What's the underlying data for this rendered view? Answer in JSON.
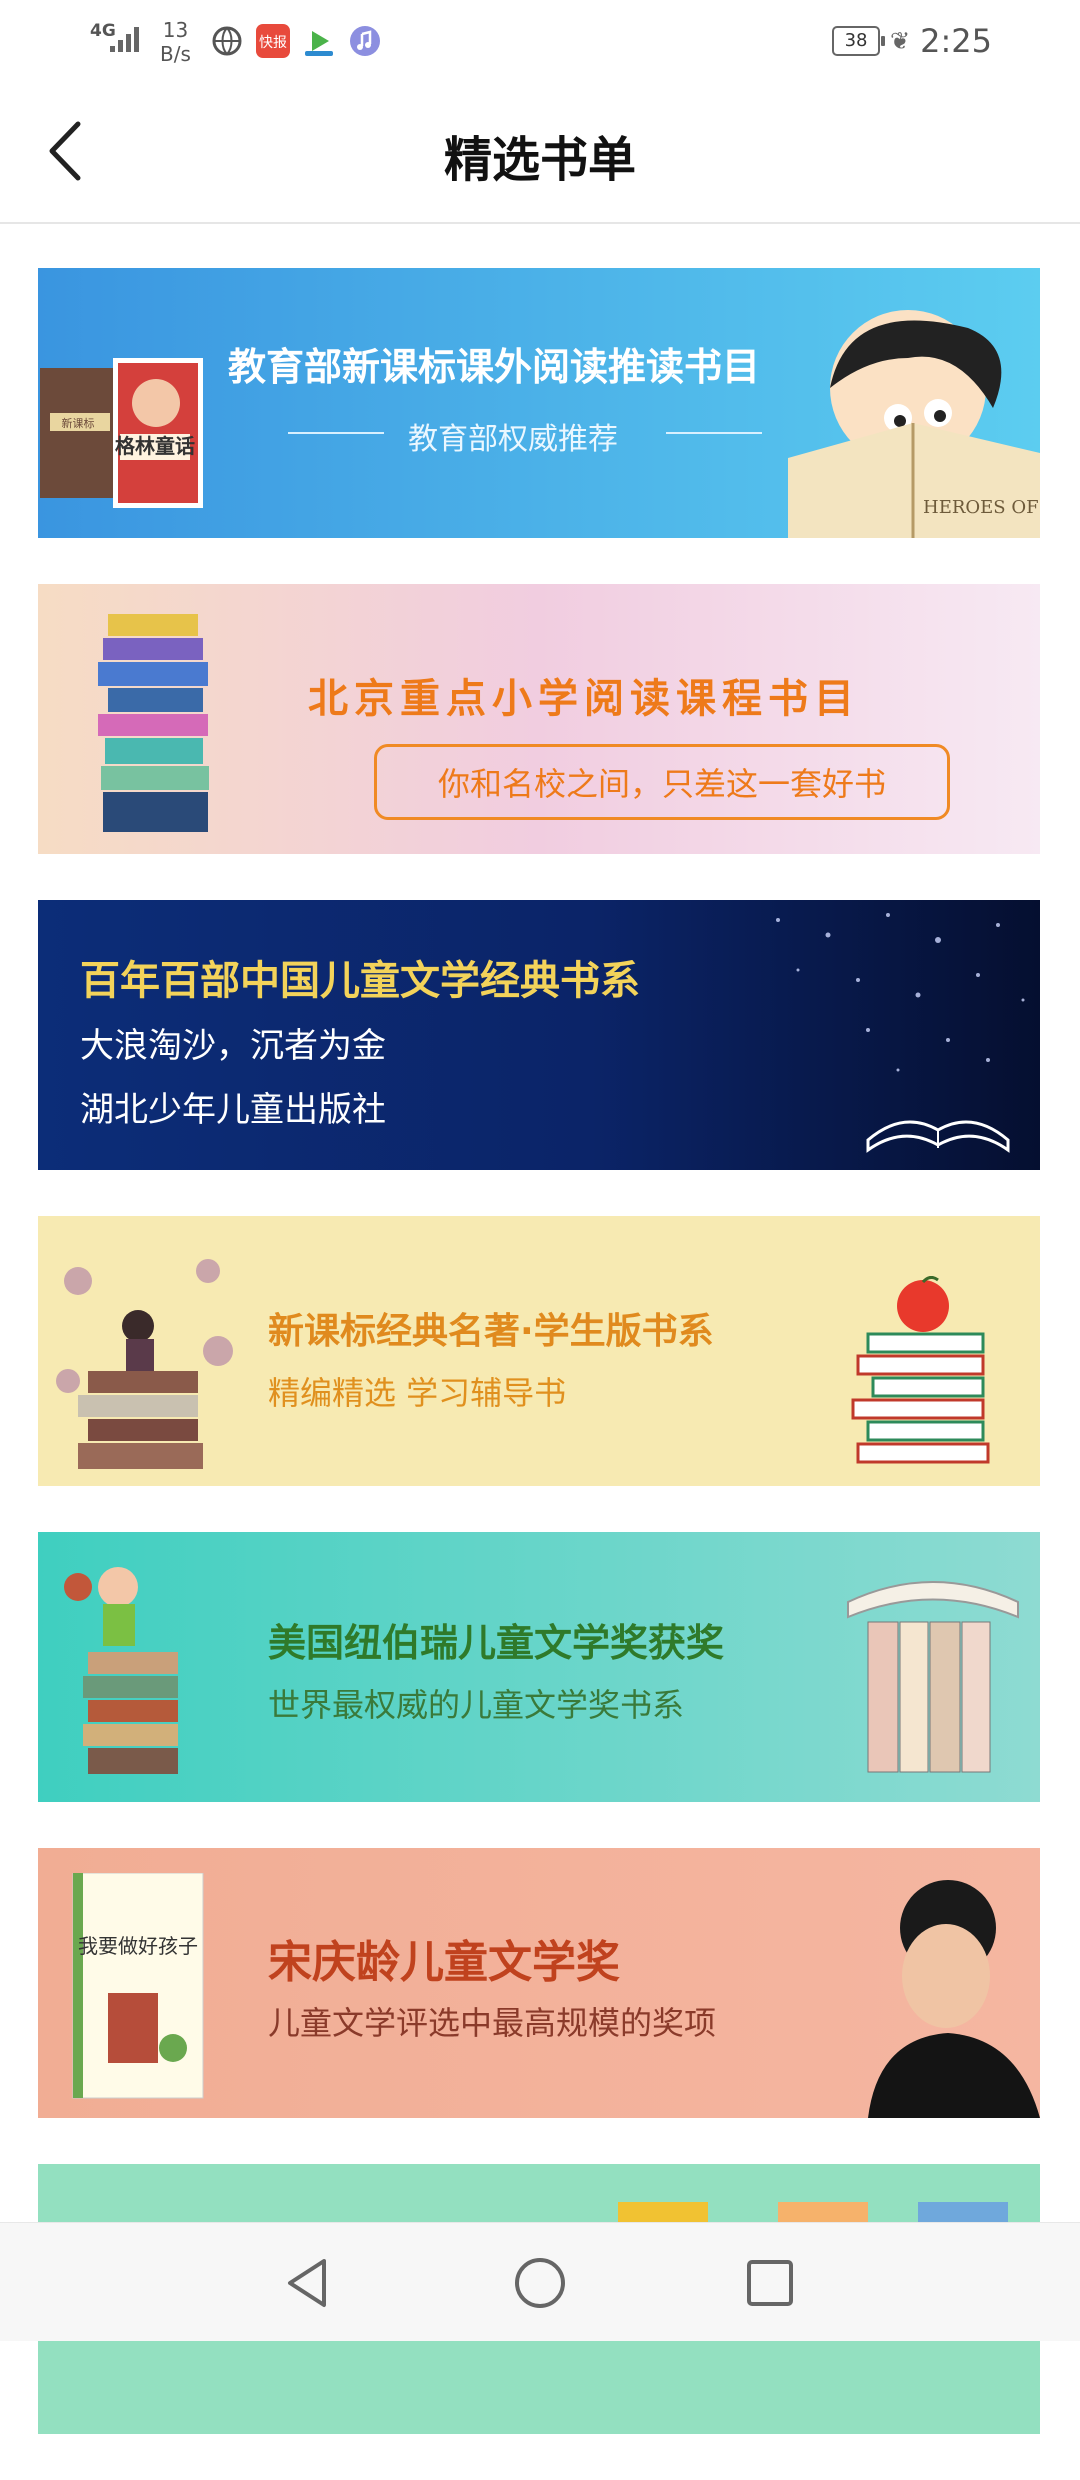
{
  "status_bar": {
    "network": "4G",
    "speed_value": "13",
    "speed_unit": "B/s",
    "battery": "38",
    "time": "2:25",
    "app_icons": [
      "globe-icon",
      "kuaibao-icon",
      "video-icon",
      "music-icon"
    ],
    "kuaibao_label": "快报"
  },
  "header": {
    "title": "精选书单",
    "back_icon": "chevron-left-icon"
  },
  "banners": [
    {
      "title": "教育部新课标课外阅读推读书目",
      "subtitle": "教育部权威推荐",
      "book_label": "格林童话",
      "book2_label": "新课标",
      "reading_book_label": "HEROES OF MYT",
      "bg": "#4aa6e6"
    },
    {
      "title": "北京重点小学阅读课程书目",
      "subtitle": "你和名校之间，只差这一套好书",
      "bg": "#f4d6e4",
      "accent": "#f08a24"
    },
    {
      "title": "百年百部中国儿童文学经典书系",
      "subtitle": "大浪淘沙，沉者为金",
      "publisher": "湖北少年儿童出版社",
      "bg": "#10307a",
      "accent": "#f3d35a"
    },
    {
      "title": "新课标经典名著·学生版书系",
      "subtitle": "精编精选  学习辅导书",
      "bg": "#f6eab0",
      "accent": "#e08a1e"
    },
    {
      "title": "美国纽伯瑞儿童文学奖获奖",
      "subtitle": "世界最权威的儿童文学奖书系",
      "bg": "#5fd6c8",
      "accent": "#2f7a2a"
    },
    {
      "title": "宋庆龄儿童文学奖",
      "subtitle": "儿童文学评选中最高规模的奖项",
      "book_label": "我要做好孩子",
      "bg": "#efab98",
      "accent": "#c0421e"
    },
    {
      "bg": "#93e0c0"
    }
  ],
  "nav": {
    "back": "back-triangle-icon",
    "home": "home-circle-icon",
    "recents": "recents-square-icon"
  }
}
